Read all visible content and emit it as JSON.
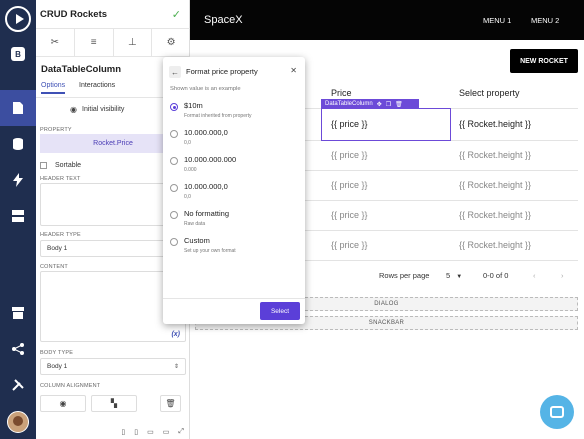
{
  "app": {
    "title": "CRUD Rockets",
    "saved_icon": "check-icon"
  },
  "rail": {
    "items": [
      "play-icon",
      "hex-b-icon",
      "page-icon",
      "database-icon",
      "bolt-icon",
      "list-icon",
      "store-icon",
      "share-icon",
      "tools-icon"
    ],
    "active": "page-icon"
  },
  "panel": {
    "tool_tabs": [
      "tools-icon",
      "database-icon",
      "hierarchy-icon",
      "gear-icon"
    ],
    "component_name": "DataTableColumn",
    "tabs": [
      "Options",
      "Interactions"
    ],
    "active_tab": "Options",
    "visibility_label": "Initial visibility",
    "property_label": "PROPERTY",
    "property_value": "Rocket.Price",
    "sortable_label": "Sortable",
    "header_text_label": "HEADER TEXT",
    "header_type_label": "HEADER TYPE",
    "header_type_value": "Body 1",
    "content_label": "CONTENT",
    "content_fx": "(x)",
    "body_type_label": "BODY TYPE",
    "body_type_value": "Body 1",
    "column_alignment_label": "COLUMN ALIGNMENT"
  },
  "appbar": {
    "title": "SpaceX",
    "menu": [
      "MENU 1",
      "MENU 2"
    ]
  },
  "table": {
    "new_button": "NEW ROCKET",
    "columns": [
      "Price",
      "Select property"
    ],
    "selected_label": "DataTableColumn",
    "rows": [
      [
        "{{ price }}",
        "{{ Rocket.height }}"
      ],
      [
        "{{ price }}",
        "{{ Rocket.height }}"
      ],
      [
        "{{ price }}",
        "{{ Rocket.height }}"
      ],
      [
        "{{ price }}",
        "{{ Rocket.height }}"
      ],
      [
        "{{ price }}",
        "{{ Rocket.height }}"
      ]
    ],
    "rows_per_page_label": "Rows per page",
    "rows_per_page_value": "5",
    "range": "0-0 of 0",
    "slots": [
      "DIALOG",
      "SNACKBAR"
    ]
  },
  "dialog": {
    "title": "Format price property",
    "subtitle": "Shown value is an example",
    "options": [
      {
        "label": "$10m",
        "sub": "Format inherited from property",
        "selected": true
      },
      {
        "label": "10.000.000,0",
        "sub": "0,0",
        "selected": false
      },
      {
        "label": "10.000.000.000",
        "sub": "0.000",
        "selected": false
      },
      {
        "label": "10.000.000,0",
        "sub": "0,0",
        "selected": false
      },
      {
        "label": "No formatting",
        "sub": "Raw data",
        "selected": false
      },
      {
        "label": "Custom",
        "sub": "Set up your own format",
        "selected": false
      }
    ],
    "select_label": "Select"
  },
  "colors": {
    "rail": "#1f2e4f",
    "accent": "#5b3fd8",
    "selection": "#6c4ad8",
    "chat": "#55b4e6"
  }
}
